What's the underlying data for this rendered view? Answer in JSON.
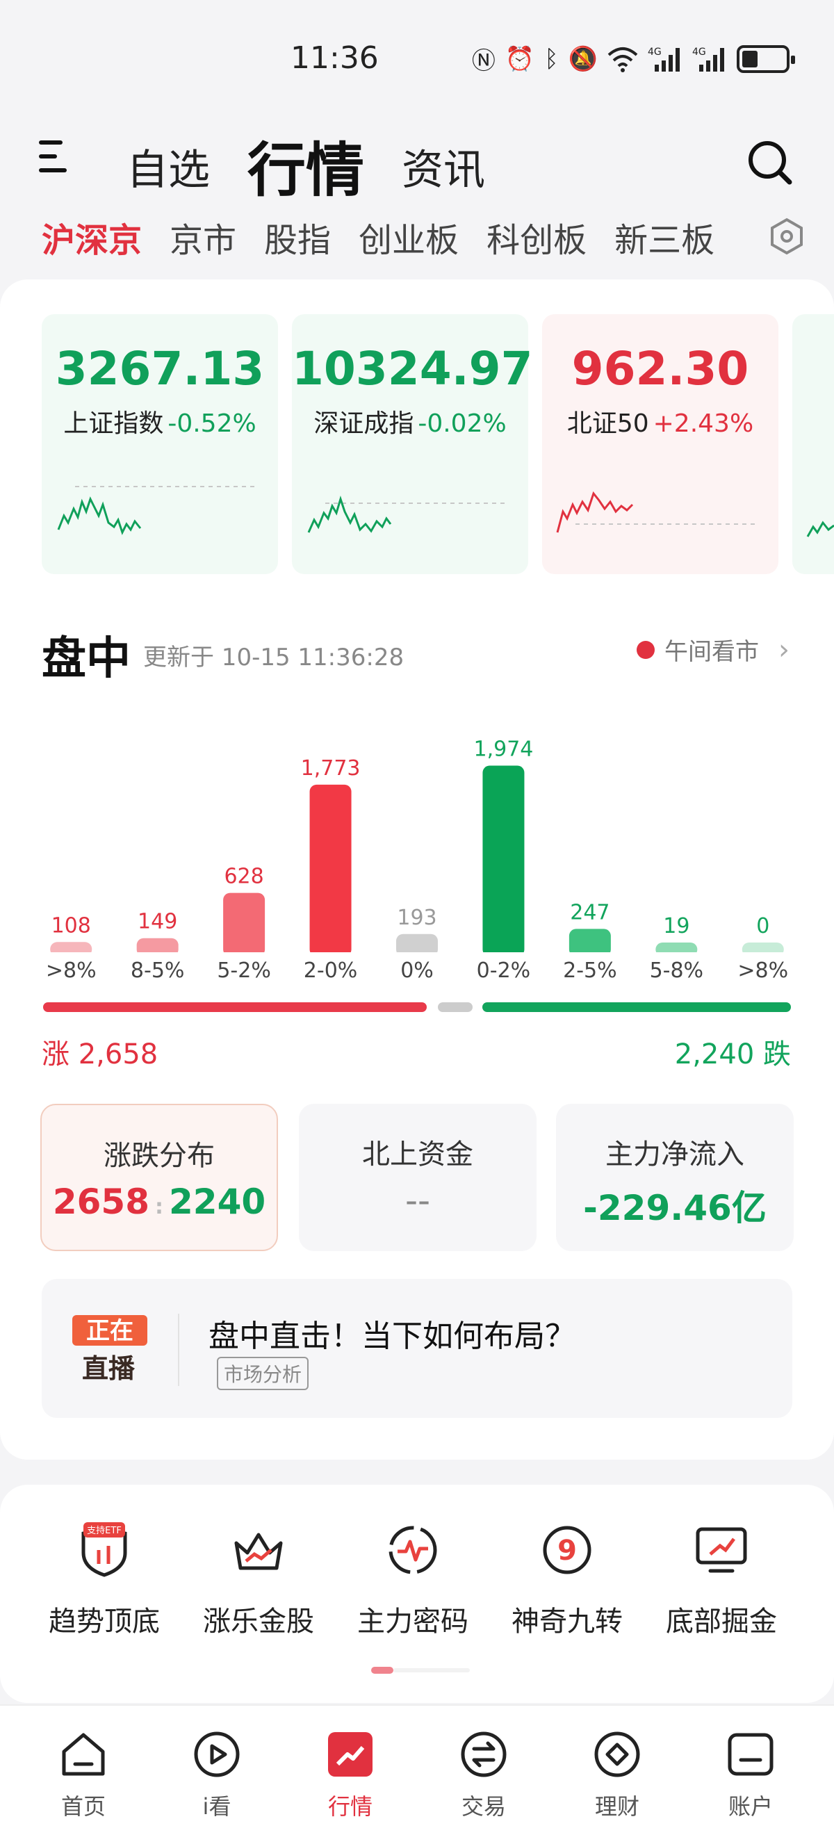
{
  "status": {
    "time": "11:36",
    "icons": [
      "nfc-icon",
      "alarm-icon",
      "bluetooth-icon",
      "mute-icon",
      "wifi-icon",
      "signal-4g-icon",
      "signal-4g-icon",
      "battery-icon"
    ]
  },
  "header": {
    "tabs": [
      {
        "label": "自选"
      },
      {
        "label": "行情",
        "active": true
      },
      {
        "label": "资讯"
      }
    ]
  },
  "sub_tabs": [
    "沪深京",
    "京市",
    "股指",
    "创业板",
    "科创板",
    "新三板"
  ],
  "indices": [
    {
      "value": "3267.13",
      "name": "上证指数",
      "change": "-0.52%",
      "trend": "down"
    },
    {
      "value": "10324.97",
      "name": "深证成指",
      "change": "-0.02%",
      "trend": "down"
    },
    {
      "value": "962.30",
      "name": "北证50",
      "change": "+2.43%",
      "trend": "up"
    }
  ],
  "section": {
    "title": "盘中",
    "update": "更新于 10-15 11:36:28",
    "link": "午间看市"
  },
  "chart_data": {
    "type": "bar",
    "categories": [
      ">8%",
      "8-5%",
      "5-2%",
      "2-0%",
      "0%",
      "0-2%",
      "2-5%",
      "5-8%",
      ">8%"
    ],
    "values": [
      108,
      149,
      628,
      1773,
      193,
      1974,
      247,
      19,
      0
    ],
    "value_labels": [
      "108",
      "149",
      "628",
      "1,773",
      "193",
      "1,974",
      "247",
      "19",
      "0"
    ],
    "colors": [
      "#f6b6bb",
      "#f59aa1",
      "#f36a74",
      "#f23945",
      "#d0d0d0",
      "#0aa456",
      "#3ec27f",
      "#8fdcb3",
      "#c7ecd8"
    ],
    "label_colors": [
      "#e1313f",
      "#e1313f",
      "#e1313f",
      "#e1313f",
      "#999999",
      "#12a45c",
      "#12a45c",
      "#12a45c",
      "#12a45c"
    ],
    "ylim": [
      0,
      2000
    ]
  },
  "summary": {
    "up": "涨 2,658",
    "down": "2,240 跌"
  },
  "stats": [
    {
      "title": "涨跌分布",
      "up": "2658",
      "down": "2240"
    },
    {
      "title": "北上资金",
      "value": "--"
    },
    {
      "title": "主力净流入",
      "value": "-229.46亿"
    }
  ],
  "live": {
    "badge_top": "正在",
    "badge_bottom": "直播",
    "title": "盘中直击！当下如何布局？",
    "tag": "市场分析"
  },
  "tools": [
    {
      "label": "趋势顶底",
      "badge": "支持ETF",
      "icon": "shield-trend-icon"
    },
    {
      "label": "涨乐金股",
      "icon": "crown-icon"
    },
    {
      "label": "主力密码",
      "icon": "pulse-target-icon"
    },
    {
      "label": "神奇九转",
      "icon": "nine-circle-icon"
    },
    {
      "label": "底部掘金",
      "icon": "monitor-up-icon"
    }
  ],
  "bottom_nav": [
    {
      "label": "首页",
      "icon": "home-icon"
    },
    {
      "label": "i看",
      "icon": "play-icon"
    },
    {
      "label": "行情",
      "icon": "chart-trend-icon",
      "active": true
    },
    {
      "label": "交易",
      "icon": "exchange-icon"
    },
    {
      "label": "理财",
      "icon": "diamond-icon"
    },
    {
      "label": "账户",
      "icon": "account-icon"
    }
  ],
  "colors": {
    "up": "#e1313f",
    "down": "#12a45c",
    "accent": "#e1313f"
  }
}
